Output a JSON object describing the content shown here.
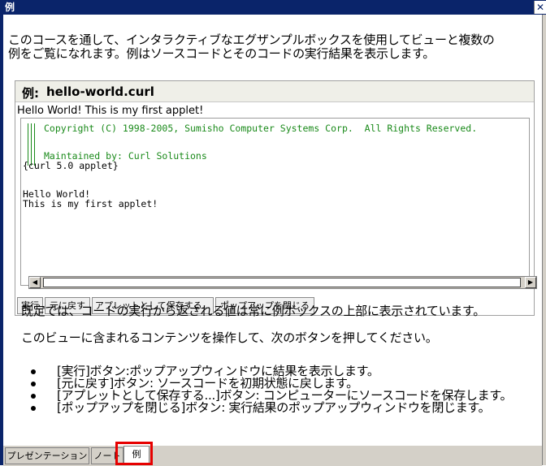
{
  "window": {
    "title": "例",
    "close_glyph": "✕"
  },
  "intro": {
    "line1": "このコースを通して、インタラクティブなエグザンプルボックスを使用してビューと複数の",
    "line2": "例をご覧になれます。例はソースコードとそのコードの実行結果を表示します。"
  },
  "example": {
    "label": "例:",
    "filename": "hello-world.curl",
    "result_text": "Hello World! This is my first applet!",
    "code": {
      "comment1": "Copyright (C) 1998-2005, Sumisho Computer Systems Corp.  All Rights Reserved.",
      "comment2": "Maintained by: Curl Solutions",
      "line1": "{curl 5.0 applet}",
      "line2": "Hello World!",
      "line3": "This is my first applet!"
    },
    "buttons": {
      "execute": "実行",
      "revert": "元に戻す",
      "save_applet": "アプレットとして保存する...",
      "close_popup": "ポップアップを閉じる"
    }
  },
  "body": {
    "para1": "既定では、コードの実行から返される値は常に例ボックスの上部に表示されています。",
    "para2": "このビューに含まれるコンテンツを操作して、次のボタンを押してください。",
    "bullets": [
      "[実行]ボタン:ポップアップウィンドウに結果を表示します。",
      "[元に戻す]ボタン: ソースコードを初期状態に戻します。",
      "[アプレットとして保存する...]ボタン: コンピューターにソースコードを保存します。",
      "[ポップアップを閉じる]ボタン: 実行結果のポップアップウィンドウを閉じます。"
    ]
  },
  "tabs": {
    "presentation": "プレゼンテーション",
    "notes": "ノート",
    "example": "例",
    "active": "例"
  },
  "colors": {
    "titlebar": "#0a246a",
    "comment": "#1a8a1a",
    "highlight": "#e60000"
  }
}
